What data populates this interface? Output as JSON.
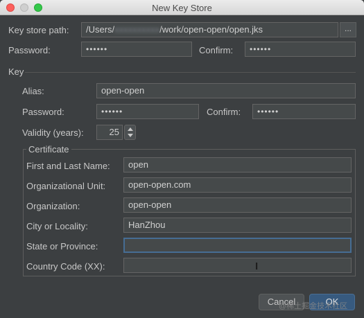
{
  "window": {
    "title": "New Key Store"
  },
  "keystore": {
    "path_label": "Key store path:",
    "path_prefix": "/Users/",
    "path_blurred": "xxxxxxxxxx",
    "path_suffix": "/work/open-open/open.jks",
    "browse_label": "...",
    "password_label": "Password:",
    "password_value": "••••••",
    "confirm_label": "Confirm:",
    "confirm_value": "••••••"
  },
  "key": {
    "section_label": "Key",
    "alias_label": "Alias:",
    "alias_value": "open-open",
    "password_label": "Password:",
    "password_value": "••••••",
    "confirm_label": "Confirm:",
    "confirm_value": "••••••",
    "validity_label": "Validity (years):",
    "validity_value": "25"
  },
  "certificate": {
    "section_label": "Certificate",
    "fields": [
      {
        "label": "First and Last Name:",
        "value": "open"
      },
      {
        "label": "Organizational Unit:",
        "value": "open-open.com"
      },
      {
        "label": "Organization:",
        "value": "open-open"
      },
      {
        "label": "City or Locality:",
        "value": "HanZhou"
      },
      {
        "label": "State or Province:",
        "value": ""
      },
      {
        "label": "Country Code (XX):",
        "value": ""
      }
    ]
  },
  "buttons": {
    "cancel": "Cancel",
    "ok": "OK"
  },
  "watermark": "@稀土掘金技术社区",
  "colors": {
    "background": "#3c3f41",
    "field": "#45494a",
    "focus_border": "#466d94",
    "ok_button": "#375a7f"
  }
}
